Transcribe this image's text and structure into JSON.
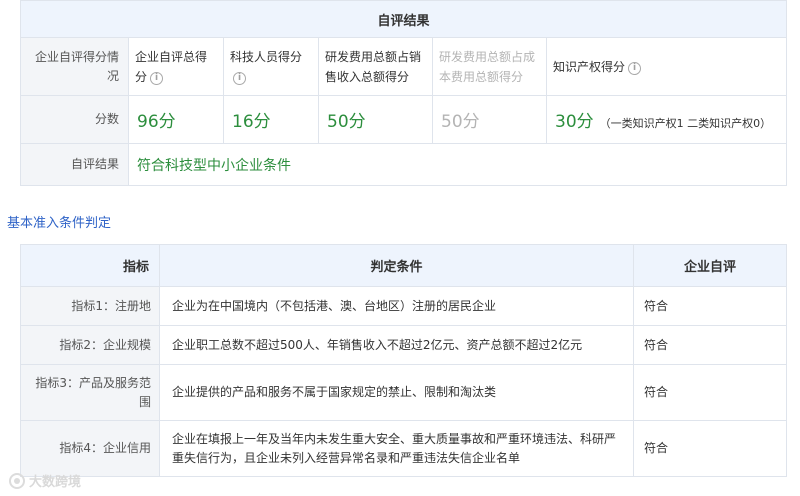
{
  "results": {
    "header": "自评结果",
    "row_score_label": "企业自评得分情况",
    "score_headers": [
      {
        "label": "企业自评总得分",
        "info": true,
        "muted": false
      },
      {
        "label": "科技人员得分",
        "info": true,
        "muted": false
      },
      {
        "label": "研发费用总额占销售收入总额得分",
        "info": false,
        "muted": false
      },
      {
        "label": "研发费用总额占成本费用总额得分",
        "info": false,
        "muted": true
      },
      {
        "label": "知识产权得分",
        "info": true,
        "muted": false
      }
    ],
    "row_points_label": "分数",
    "scores": [
      "96分",
      "16分",
      "50分",
      "50分",
      "30分"
    ],
    "ip_breakdown": "（一类知识产权1 二类知识产权0）",
    "row_result_label": "自评结果",
    "result_text": "符合科技型中小企业条件"
  },
  "section_title": "基本准入条件判定",
  "criteria": {
    "headers": [
      "指标",
      "判定条件",
      "企业自评"
    ],
    "rows": [
      {
        "indicator": "指标1：注册地",
        "condition": "企业为在中国境内（不包括港、澳、台地区）注册的居民企业",
        "evaluation": "符合"
      },
      {
        "indicator": "指标2：企业规模",
        "condition": "企业职工总数不超过500人、年销售收入不超过2亿元、资产总额不超过2亿元",
        "evaluation": "符合"
      },
      {
        "indicator": "指标3：产品及服务范围",
        "condition": "企业提供的产品和服务不属于国家规定的禁止、限制和淘汰类",
        "evaluation": "符合"
      },
      {
        "indicator": "指标4：企业信用",
        "condition": "企业在填报上一年及当年内未发生重大安全、重大质量事故和严重环境违法、科研严重失信行为，且企业未列入经营异常名录和严重违法失信企业名单",
        "evaluation": "符合"
      }
    ]
  },
  "watermark": "大数跨境",
  "colors": {
    "accent_green": "#2c8e3d",
    "link_blue": "#2f63c7",
    "header_bg": "#eef4fd",
    "label_bg": "#f3f5f8",
    "muted": "#b4b4b4"
  },
  "icons": {
    "info": "info-circle-icon",
    "watermark_logo": "watermark-logo-icon"
  }
}
